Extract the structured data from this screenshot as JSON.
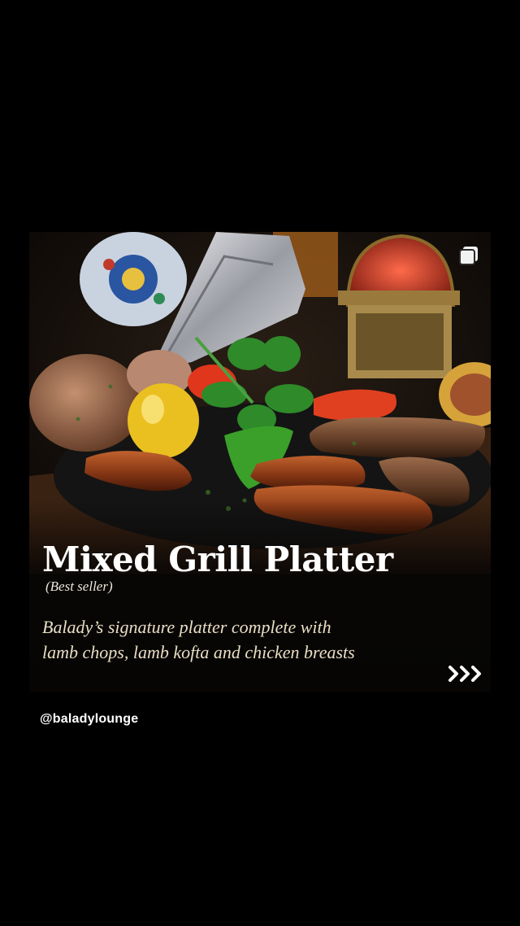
{
  "post": {
    "title": "Mixed Grill Platter",
    "subtitle": "(Best seller)",
    "description_lines": [
      "Balady’s signature platter complete with",
      "lamb chops, lamb kofta and chicken breasts"
    ],
    "username": "@baladylounge"
  },
  "icons": {
    "multi_post": "stacked-squares-icon",
    "next": "triple-chevron-right-icon"
  },
  "colors": {
    "background": "#000000",
    "description_text": "#e9ddc4",
    "title_text": "#ffffff"
  }
}
